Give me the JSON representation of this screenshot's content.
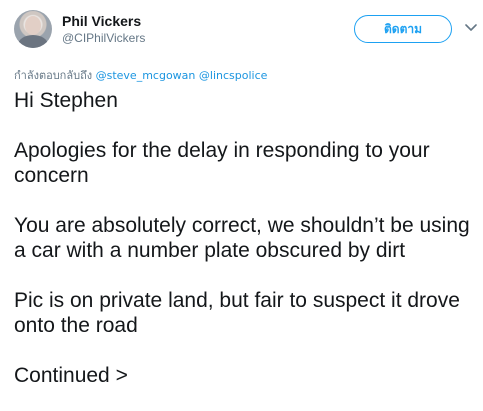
{
  "author": {
    "name": "Phil Vickers",
    "handle": "@CIPhilVickers"
  },
  "follow_button": {
    "label": "ติดตาม"
  },
  "menu": {
    "icon": "chevron-down-icon"
  },
  "reply_context": {
    "prefix": "กำลังตอบกลับถึง",
    "mentions": [
      "@steve_mcgowan",
      "@lincspolice"
    ]
  },
  "tweet": {
    "paragraphs": [
      "Hi Stephen",
      "Apologies for the delay in responding to your concern",
      "You are absolutely correct, we shouldn’t be using a car with a number plate obscured by dirt",
      "Pic is on private land, but fair to suspect it drove onto the road",
      "Continued >"
    ]
  },
  "colors": {
    "accent": "#1da1f2",
    "mention": "#1b95e0",
    "text": "#14171a",
    "secondary": "#657786"
  }
}
